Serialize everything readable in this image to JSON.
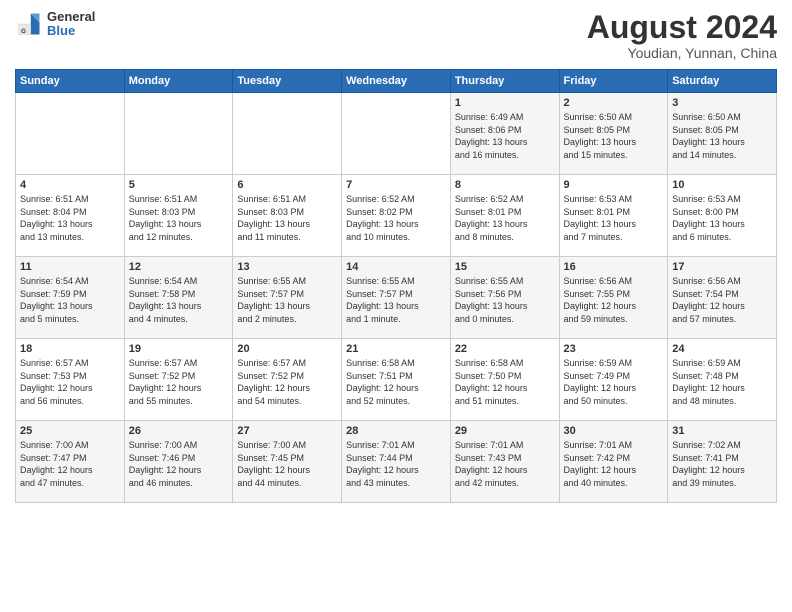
{
  "header": {
    "logo_general": "General",
    "logo_blue": "Blue",
    "month_title": "August 2024",
    "location": "Youdian, Yunnan, China"
  },
  "weekdays": [
    "Sunday",
    "Monday",
    "Tuesday",
    "Wednesday",
    "Thursday",
    "Friday",
    "Saturday"
  ],
  "weeks": [
    [
      {
        "day": "",
        "info": ""
      },
      {
        "day": "",
        "info": ""
      },
      {
        "day": "",
        "info": ""
      },
      {
        "day": "",
        "info": ""
      },
      {
        "day": "1",
        "info": "Sunrise: 6:49 AM\nSunset: 8:06 PM\nDaylight: 13 hours\nand 16 minutes."
      },
      {
        "day": "2",
        "info": "Sunrise: 6:50 AM\nSunset: 8:05 PM\nDaylight: 13 hours\nand 15 minutes."
      },
      {
        "day": "3",
        "info": "Sunrise: 6:50 AM\nSunset: 8:05 PM\nDaylight: 13 hours\nand 14 minutes."
      }
    ],
    [
      {
        "day": "4",
        "info": "Sunrise: 6:51 AM\nSunset: 8:04 PM\nDaylight: 13 hours\nand 13 minutes."
      },
      {
        "day": "5",
        "info": "Sunrise: 6:51 AM\nSunset: 8:03 PM\nDaylight: 13 hours\nand 12 minutes."
      },
      {
        "day": "6",
        "info": "Sunrise: 6:51 AM\nSunset: 8:03 PM\nDaylight: 13 hours\nand 11 minutes."
      },
      {
        "day": "7",
        "info": "Sunrise: 6:52 AM\nSunset: 8:02 PM\nDaylight: 13 hours\nand 10 minutes."
      },
      {
        "day": "8",
        "info": "Sunrise: 6:52 AM\nSunset: 8:01 PM\nDaylight: 13 hours\nand 8 minutes."
      },
      {
        "day": "9",
        "info": "Sunrise: 6:53 AM\nSunset: 8:01 PM\nDaylight: 13 hours\nand 7 minutes."
      },
      {
        "day": "10",
        "info": "Sunrise: 6:53 AM\nSunset: 8:00 PM\nDaylight: 13 hours\nand 6 minutes."
      }
    ],
    [
      {
        "day": "11",
        "info": "Sunrise: 6:54 AM\nSunset: 7:59 PM\nDaylight: 13 hours\nand 5 minutes."
      },
      {
        "day": "12",
        "info": "Sunrise: 6:54 AM\nSunset: 7:58 PM\nDaylight: 13 hours\nand 4 minutes."
      },
      {
        "day": "13",
        "info": "Sunrise: 6:55 AM\nSunset: 7:57 PM\nDaylight: 13 hours\nand 2 minutes."
      },
      {
        "day": "14",
        "info": "Sunrise: 6:55 AM\nSunset: 7:57 PM\nDaylight: 13 hours\nand 1 minute."
      },
      {
        "day": "15",
        "info": "Sunrise: 6:55 AM\nSunset: 7:56 PM\nDaylight: 13 hours\nand 0 minutes."
      },
      {
        "day": "16",
        "info": "Sunrise: 6:56 AM\nSunset: 7:55 PM\nDaylight: 12 hours\nand 59 minutes."
      },
      {
        "day": "17",
        "info": "Sunrise: 6:56 AM\nSunset: 7:54 PM\nDaylight: 12 hours\nand 57 minutes."
      }
    ],
    [
      {
        "day": "18",
        "info": "Sunrise: 6:57 AM\nSunset: 7:53 PM\nDaylight: 12 hours\nand 56 minutes."
      },
      {
        "day": "19",
        "info": "Sunrise: 6:57 AM\nSunset: 7:52 PM\nDaylight: 12 hours\nand 55 minutes."
      },
      {
        "day": "20",
        "info": "Sunrise: 6:57 AM\nSunset: 7:52 PM\nDaylight: 12 hours\nand 54 minutes."
      },
      {
        "day": "21",
        "info": "Sunrise: 6:58 AM\nSunset: 7:51 PM\nDaylight: 12 hours\nand 52 minutes."
      },
      {
        "day": "22",
        "info": "Sunrise: 6:58 AM\nSunset: 7:50 PM\nDaylight: 12 hours\nand 51 minutes."
      },
      {
        "day": "23",
        "info": "Sunrise: 6:59 AM\nSunset: 7:49 PM\nDaylight: 12 hours\nand 50 minutes."
      },
      {
        "day": "24",
        "info": "Sunrise: 6:59 AM\nSunset: 7:48 PM\nDaylight: 12 hours\nand 48 minutes."
      }
    ],
    [
      {
        "day": "25",
        "info": "Sunrise: 7:00 AM\nSunset: 7:47 PM\nDaylight: 12 hours\nand 47 minutes."
      },
      {
        "day": "26",
        "info": "Sunrise: 7:00 AM\nSunset: 7:46 PM\nDaylight: 12 hours\nand 46 minutes."
      },
      {
        "day": "27",
        "info": "Sunrise: 7:00 AM\nSunset: 7:45 PM\nDaylight: 12 hours\nand 44 minutes."
      },
      {
        "day": "28",
        "info": "Sunrise: 7:01 AM\nSunset: 7:44 PM\nDaylight: 12 hours\nand 43 minutes."
      },
      {
        "day": "29",
        "info": "Sunrise: 7:01 AM\nSunset: 7:43 PM\nDaylight: 12 hours\nand 42 minutes."
      },
      {
        "day": "30",
        "info": "Sunrise: 7:01 AM\nSunset: 7:42 PM\nDaylight: 12 hours\nand 40 minutes."
      },
      {
        "day": "31",
        "info": "Sunrise: 7:02 AM\nSunset: 7:41 PM\nDaylight: 12 hours\nand 39 minutes."
      }
    ]
  ]
}
